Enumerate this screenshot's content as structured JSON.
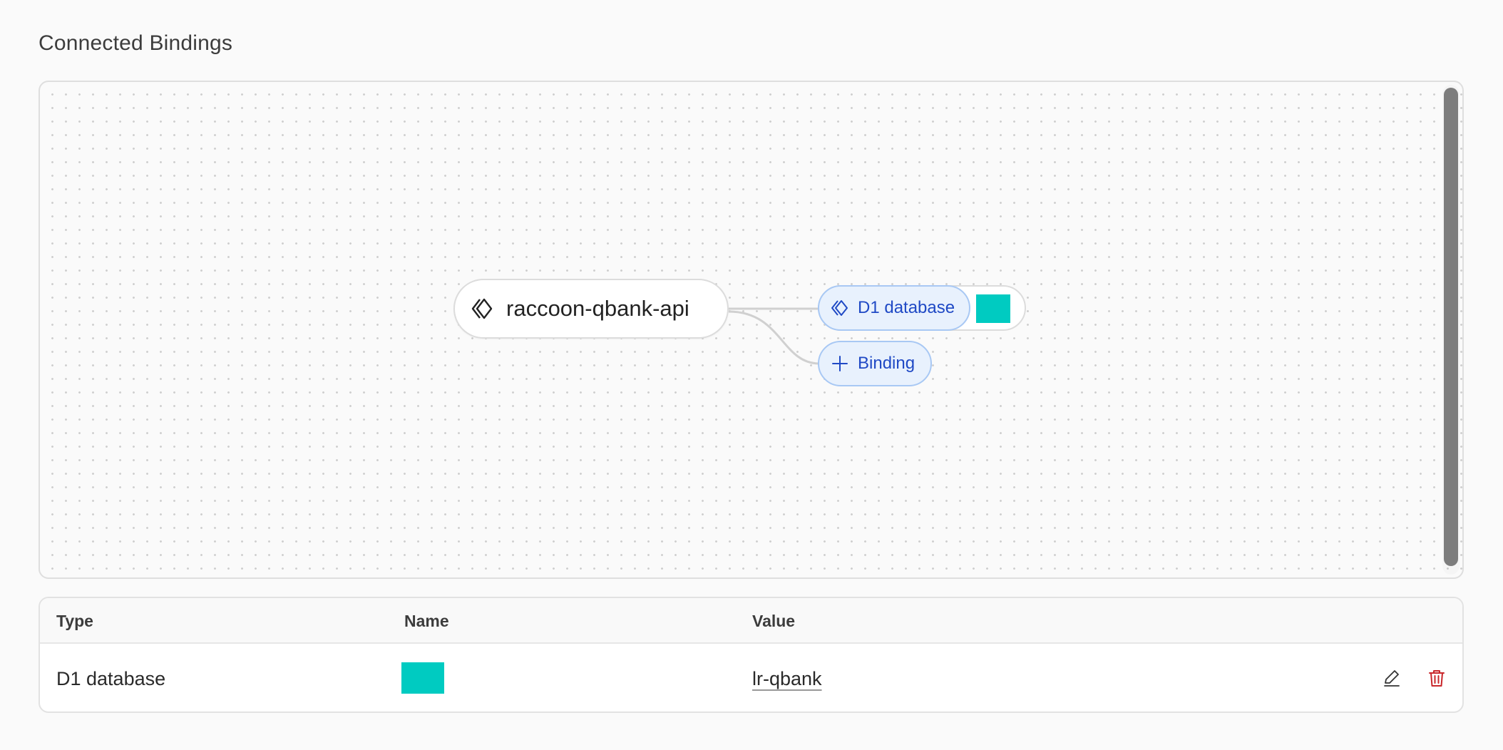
{
  "section": {
    "title": "Connected Bindings"
  },
  "graph": {
    "worker_node": {
      "label": "raccoon-qbank-api",
      "icon": "worker-diamond-icon"
    },
    "binding_node": {
      "label": "D1 database",
      "icon": "d1-diamond-icon",
      "swatch_color": "#00cbc1"
    },
    "add_binding": {
      "label": "Binding",
      "icon": "plus-icon"
    }
  },
  "table": {
    "columns": [
      "Type",
      "Name",
      "Value"
    ],
    "rows": [
      {
        "type": "D1 database",
        "name_swatch_color": "#00cbc1",
        "value": "lr-qbank"
      }
    ],
    "actions": {
      "edit_icon": "pencil-icon",
      "delete_icon": "trash-icon"
    }
  },
  "colors": {
    "accent_blue": "#1f49c5",
    "pill_bg": "#e8f1fd",
    "danger_red": "#c9272b",
    "swatch_teal": "#00cbc1"
  }
}
